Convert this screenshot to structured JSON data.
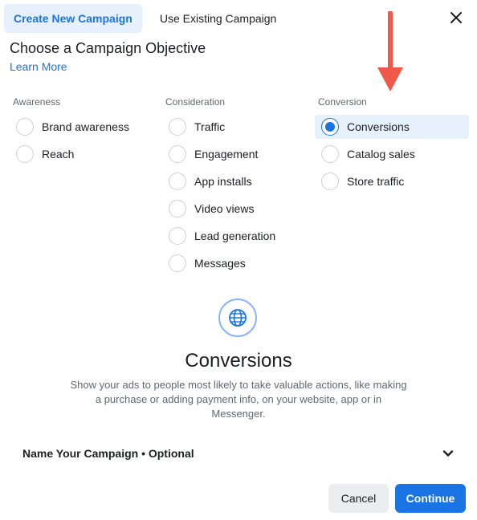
{
  "tabs": [
    {
      "label": "Create New Campaign",
      "active": true
    },
    {
      "label": "Use Existing Campaign",
      "active": false
    }
  ],
  "heading": "Choose a Campaign Objective",
  "learn_more": "Learn More",
  "columns": [
    {
      "title": "Awareness",
      "options": [
        "Brand awareness",
        "Reach"
      ]
    },
    {
      "title": "Consideration",
      "options": [
        "Traffic",
        "Engagement",
        "App installs",
        "Video views",
        "Lead generation",
        "Messages"
      ]
    },
    {
      "title": "Conversion",
      "options": [
        "Conversions",
        "Catalog sales",
        "Store traffic"
      ]
    }
  ],
  "selected_option": "Conversions",
  "objective": {
    "title": "Conversions",
    "description": "Show your ads to people most likely to take valuable actions, like making a purchase or adding payment info, on your website, app or in Messenger."
  },
  "name_campaign": "Name Your Campaign • Optional",
  "buttons": {
    "cancel": "Cancel",
    "continue": "Continue"
  },
  "colors": {
    "accent": "#1b74e4",
    "selected_bg": "#e7f0fd",
    "arrow": "#f0584a"
  }
}
